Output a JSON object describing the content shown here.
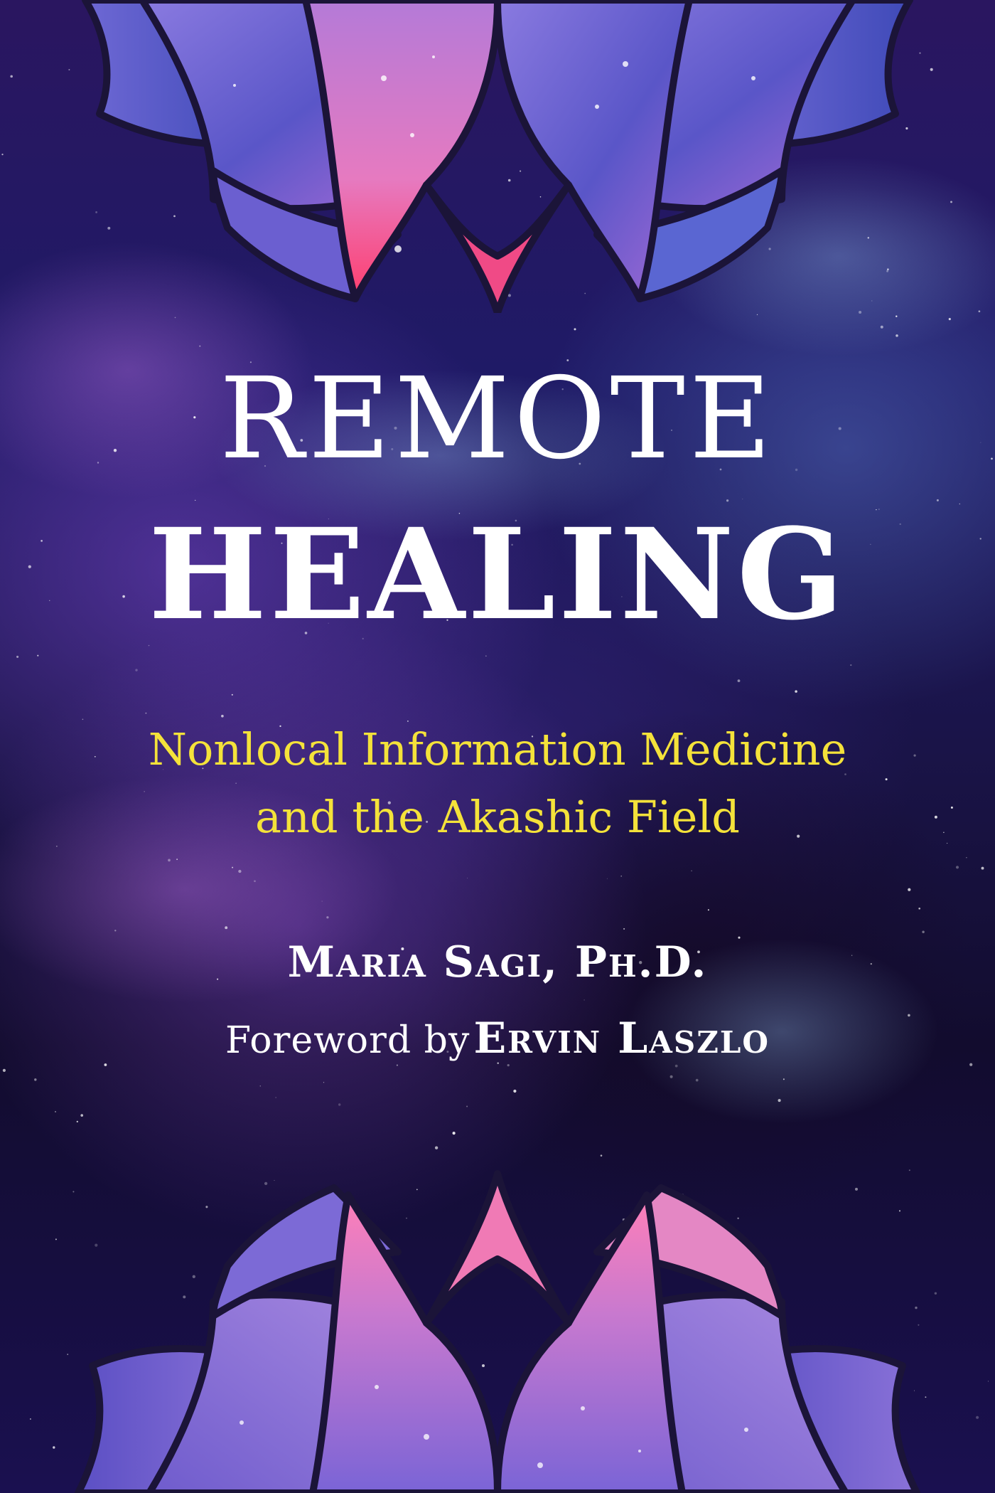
{
  "cover": {
    "title_line1": "REMOTE",
    "title_line2": "HEALING",
    "subtitle_line1": "Nonlocal Information Medicine",
    "subtitle_line2": "and the Akashic Field",
    "author": "Maria Sagi, Ph.D.",
    "foreword_lead": "Foreword by",
    "foreword_name": "Ervin Laszlo"
  },
  "colors": {
    "title": "#ffffff",
    "subtitle": "#f4e23a",
    "background": "#1a1448",
    "lotus_outline": "#1b1438"
  },
  "icons": {
    "top_ornament": "lotus-icon",
    "bottom_ornament": "lotus-icon"
  }
}
